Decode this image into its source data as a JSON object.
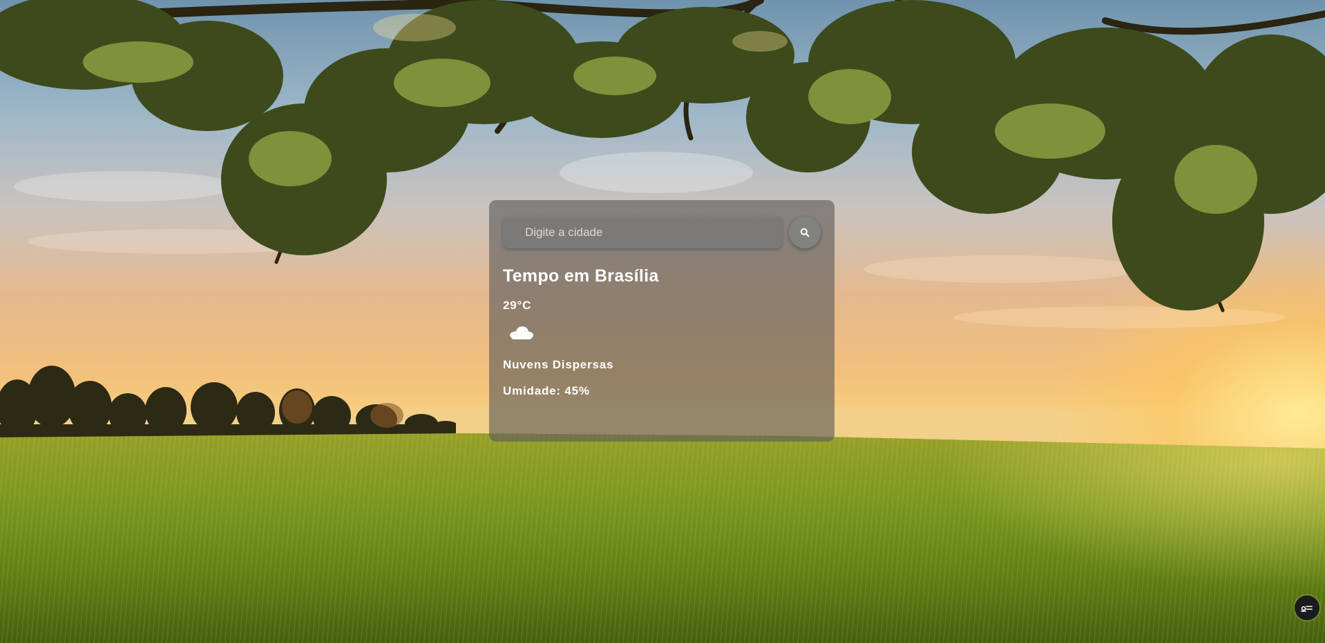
{
  "search": {
    "placeholder": "Digite a cidade",
    "button_icon": "search-icon"
  },
  "weather": {
    "title": "Tempo em Brasília",
    "temperature": "29°C",
    "icon": "cloud-icon",
    "description": "Nuvens Dispersas",
    "humidity": "Umidade: 45%"
  },
  "floating_button": {
    "icon": "settings-toggle-icon"
  },
  "colors": {
    "card_background": "#5a5a5a",
    "text": "#ffffff",
    "fab_background": "#1b1b1b"
  }
}
